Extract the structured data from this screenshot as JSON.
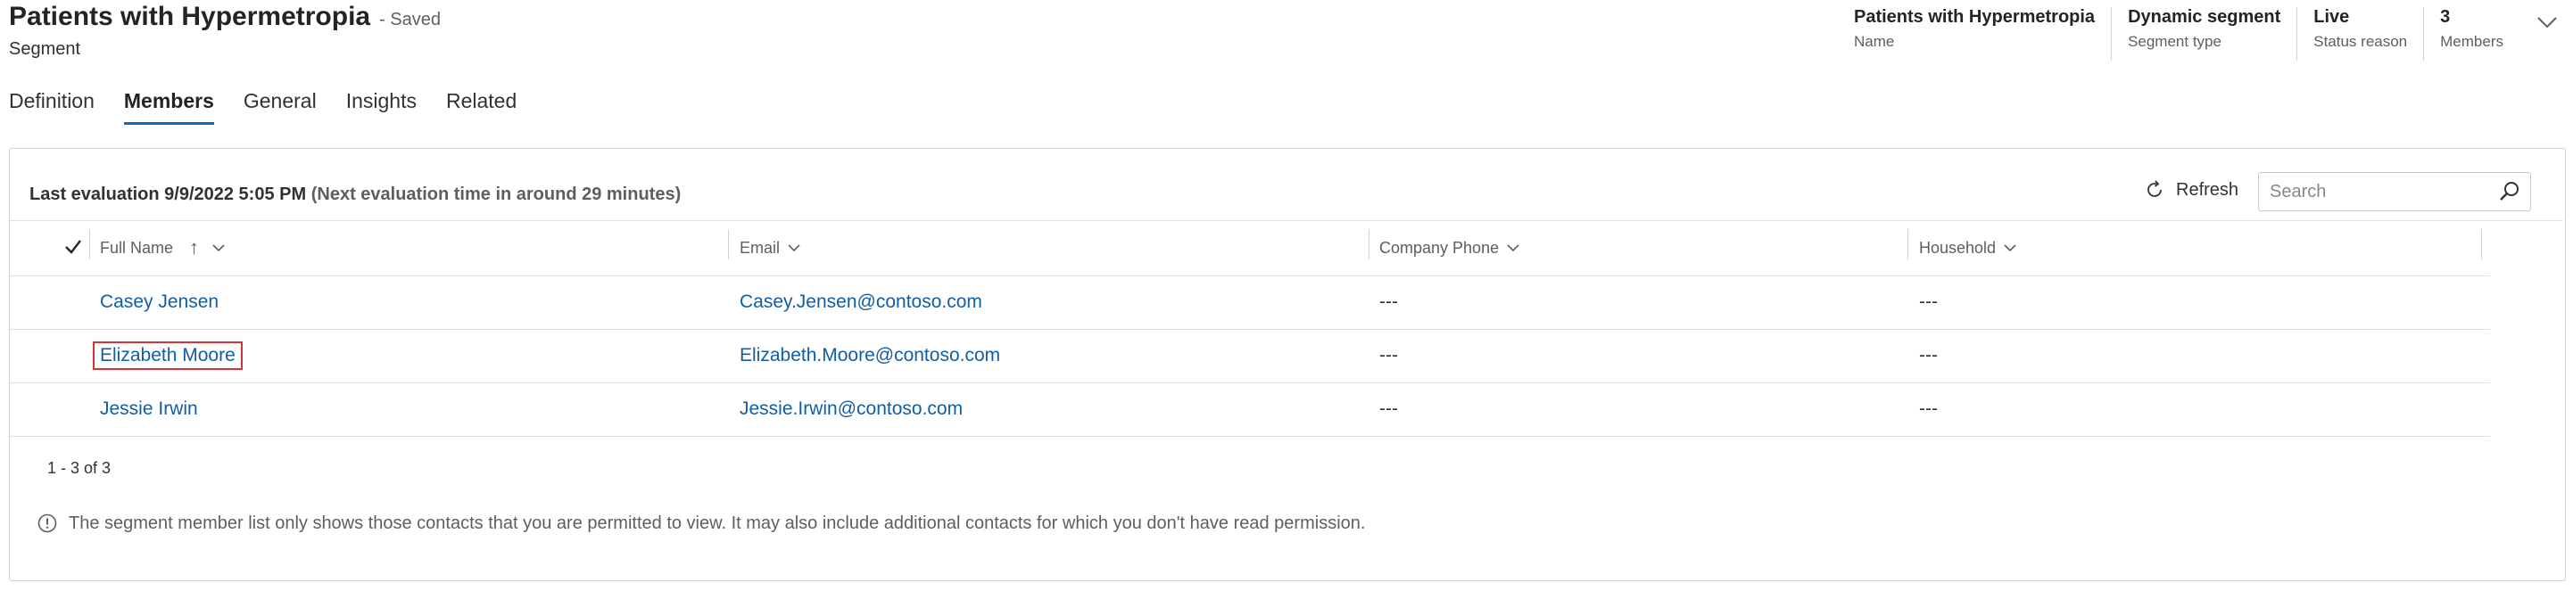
{
  "record": {
    "title": "Patients with Hypermetropia",
    "saved_status": "- Saved",
    "entity_type": "Segment"
  },
  "header_fields": [
    {
      "value": "Patients with Hypermetropia",
      "label": "Name"
    },
    {
      "value": "Dynamic segment",
      "label": "Segment type"
    },
    {
      "value": "Live",
      "label": "Status reason"
    },
    {
      "value": "3",
      "label": "Members"
    }
  ],
  "tabs": [
    {
      "label": "Definition",
      "active": false
    },
    {
      "label": "Members",
      "active": true
    },
    {
      "label": "General",
      "active": false
    },
    {
      "label": "Insights",
      "active": false
    },
    {
      "label": "Related",
      "active": false
    }
  ],
  "members": {
    "evaluation_label": "Last evaluation 9/9/2022 5:05 PM",
    "next_evaluation": "(Next evaluation time in around 29 minutes)",
    "refresh_label": "Refresh",
    "search_placeholder": "Search",
    "columns": [
      "Full Name",
      "Email",
      "Company Phone",
      "Household"
    ],
    "sort_indicator": "↑",
    "rows": [
      {
        "full_name": "Casey Jensen",
        "email": "Casey.Jensen@contoso.com",
        "company_phone": "---",
        "household": "---"
      },
      {
        "full_name": "Elizabeth Moore",
        "email": "Elizabeth.Moore@contoso.com",
        "company_phone": "---",
        "household": "---",
        "highlighted": true
      },
      {
        "full_name": "Jessie Irwin",
        "email": "Jessie.Irwin@contoso.com",
        "company_phone": "---",
        "household": "---"
      }
    ],
    "record_count": "1 - 3 of 3",
    "info_note": "The segment member list only shows those contacts that you are permitted to view. It may also include additional contacts for which you don't have read permission."
  },
  "colors": {
    "accent": "#0f6cbd",
    "link": "#115ea3",
    "highlight_border": "#d13438"
  }
}
